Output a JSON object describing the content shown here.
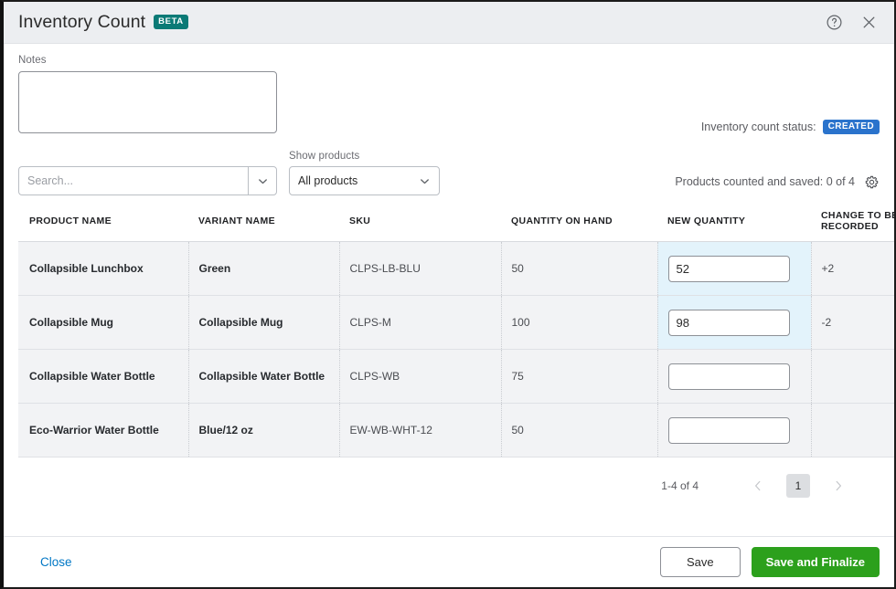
{
  "header": {
    "title": "Inventory Count",
    "beta_badge": "BETA",
    "help_icon": "help-circle-icon",
    "close_icon": "close-icon"
  },
  "notes": {
    "label": "Notes",
    "value": "",
    "placeholder": ""
  },
  "status": {
    "label": "Inventory count status:",
    "value": "CREATED",
    "badge_color": "#2a73cc"
  },
  "search": {
    "placeholder": "Search...",
    "value": "",
    "caret_icon": "chevron-down-icon"
  },
  "show_products": {
    "label": "Show products",
    "selected": "All products",
    "caret_icon": "chevron-down-icon"
  },
  "counted": {
    "text": "Products counted and saved: 0 of 4",
    "settings_icon": "gear-icon"
  },
  "table": {
    "columns": [
      "PRODUCT NAME",
      "VARIANT NAME",
      "SKU",
      "QUANTITY ON HAND",
      "NEW QUANTITY",
      "CHANGE TO BE RECORDED"
    ],
    "rows": [
      {
        "product_name": "Collapsible Lunchbox",
        "variant_name": "Green",
        "sku": "CLPS-LB-BLU",
        "quantity_on_hand": "50",
        "new_quantity": "52",
        "change": "+2",
        "highlighted": true
      },
      {
        "product_name": "Collapsible Mug",
        "variant_name": "Collapsible Mug",
        "sku": "CLPS-M",
        "quantity_on_hand": "100",
        "new_quantity": "98",
        "change": "-2",
        "highlighted": true
      },
      {
        "product_name": "Collapsible Water Bottle",
        "variant_name": "Collapsible Water Bottle",
        "sku": "CLPS-WB",
        "quantity_on_hand": "75",
        "new_quantity": "",
        "change": "",
        "highlighted": false
      },
      {
        "product_name": "Eco-Warrior Water Bottle",
        "variant_name": "Blue/12 oz",
        "sku": "EW-WB-WHT-12",
        "quantity_on_hand": "50",
        "new_quantity": "",
        "change": "",
        "highlighted": false
      }
    ]
  },
  "pagination": {
    "range": "1-4 of 4",
    "prev_icon": "chevron-left-icon",
    "current_page": "1",
    "next_icon": "chevron-right-icon"
  },
  "footer": {
    "close_label": "Close",
    "save_label": "Save",
    "finalize_label": "Save and Finalize",
    "primary_color": "#2ca01c"
  }
}
